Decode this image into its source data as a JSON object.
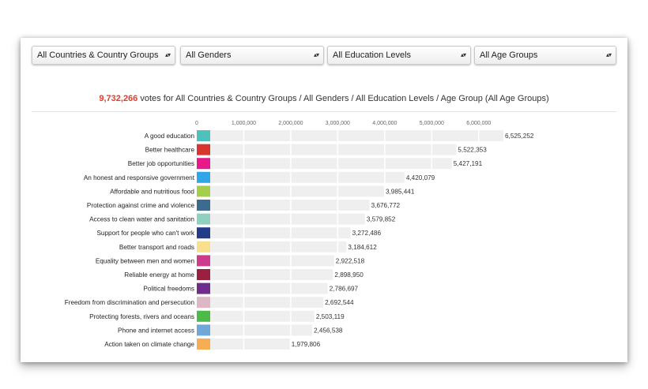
{
  "filters": [
    {
      "value": "All Countries & Country Groups"
    },
    {
      "value": "All Genders"
    },
    {
      "value": "All Education Levels"
    },
    {
      "value": "All Age Groups"
    }
  ],
  "summary": {
    "total": "9,732,266",
    "text": "votes for All Countries & Country Groups / All Genders / All Education Levels / Age Group (All Age Groups)"
  },
  "colors": {
    "bar_bg": "#efefef",
    "total_red": "#e63a2a"
  },
  "chart_data": {
    "type": "bar",
    "orientation": "horizontal",
    "title": "",
    "xlabel": "",
    "ylabel": "",
    "xlim": [
      0,
      6525252
    ],
    "ticks": [
      0,
      1000000,
      2000000,
      3000000,
      4000000,
      5000000,
      6000000
    ],
    "tick_labels": [
      "0",
      "1,000,000",
      "2,000,000",
      "3,000,000",
      "4,000,000",
      "5,000,000",
      "6,000,000"
    ],
    "categories": [
      "A good education",
      "Better healthcare",
      "Better job opportunities",
      "An honest and responsive government",
      "Affordable and nutritious food",
      "Protection against crime and violence",
      "Access to clean water and sanitation",
      "Support for people who can't work",
      "Better transport and roads",
      "Equality between men and women",
      "Reliable energy at home",
      "Political freedoms",
      "Freedom from discrimination and persecution",
      "Protecting forests, rivers and oceans",
      "Phone and internet access",
      "Action taken on climate change"
    ],
    "values": [
      6525252,
      5522353,
      5427191,
      4420079,
      3985441,
      3676772,
      3579852,
      3272486,
      3184612,
      2922518,
      2898950,
      2786697,
      2692544,
      2503119,
      2456538,
      1979806
    ],
    "value_labels": [
      "6,525,252",
      "5,522,353",
      "5,427,191",
      "4,420,079",
      "3,985,441",
      "3,676,772",
      "3,579,852",
      "3,272,486",
      "3,184,612",
      "2,922,518",
      "2,898,950",
      "2,786,697",
      "2,692,544",
      "2,503,119",
      "2,456,538",
      "1,979,806"
    ],
    "swatch_colors": [
      "#4fc1bd",
      "#d7352d",
      "#e8188b",
      "#31a6e6",
      "#a6ce4e",
      "#3b6c8e",
      "#8fd0c3",
      "#233c8a",
      "#f8df8c",
      "#cd3c8c",
      "#9a1f41",
      "#6e2c8c",
      "#ddb7c6",
      "#4cb949",
      "#6ea8d8",
      "#f6ad54"
    ],
    "grid": true
  }
}
